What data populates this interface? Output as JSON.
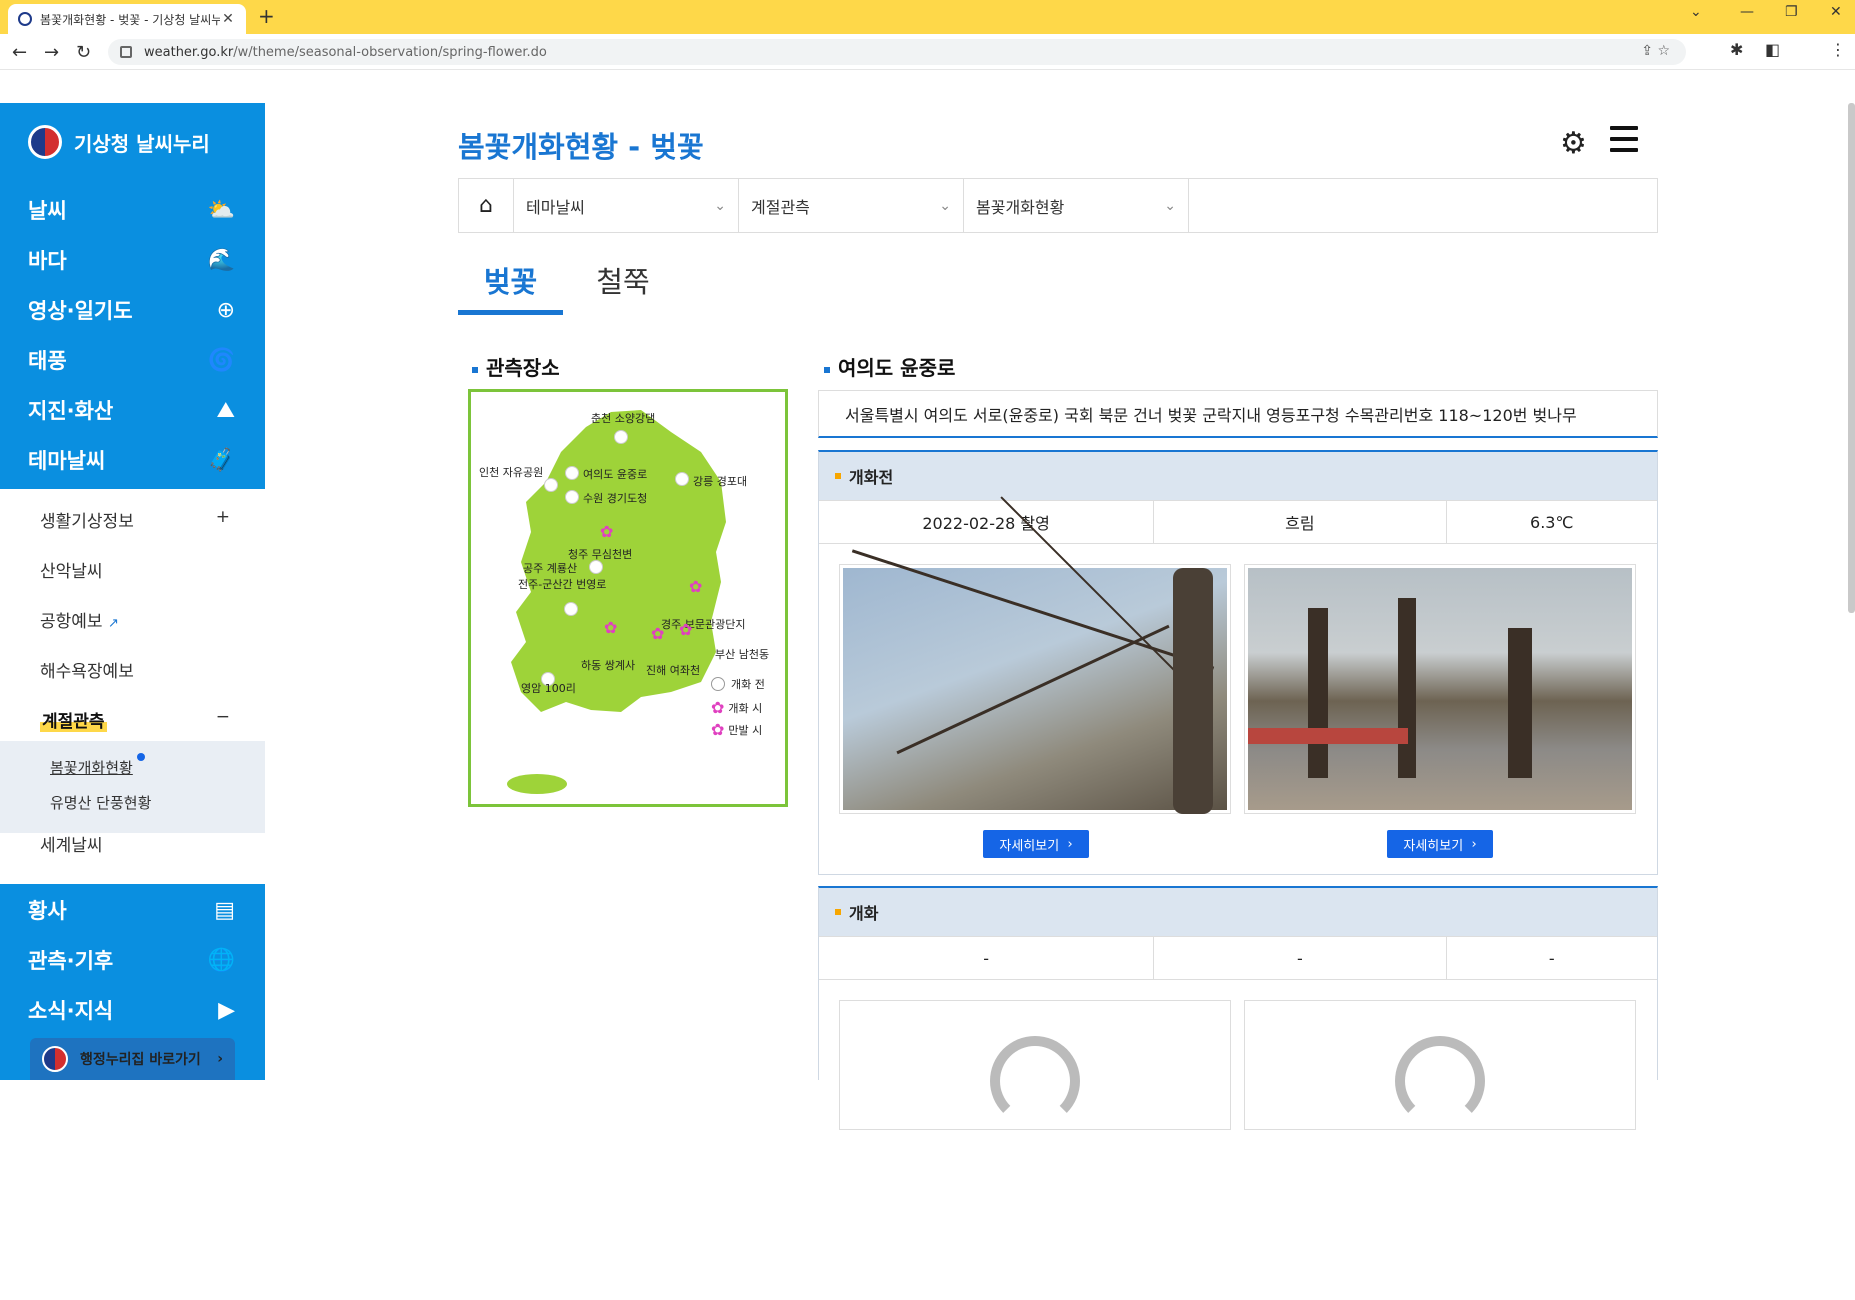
{
  "browser": {
    "tab_title": "봄꽃개화현황 - 벚꽃 - 기상청 날씨누리",
    "new_tab": "+",
    "url_host": "weather.go.kr",
    "url_path": "/w/theme/seasonal-observation/spring-flower.do"
  },
  "sidebar": {
    "logo": "기상청 날씨누리",
    "main_items": [
      {
        "label": "날씨",
        "icon": "weather-icon"
      },
      {
        "label": "바다",
        "icon": "sea-icon"
      },
      {
        "label": "영상·일기도",
        "icon": "radar-icon"
      },
      {
        "label": "태풍",
        "icon": "typhoon-icon"
      },
      {
        "label": "지진·화산",
        "icon": "earthquake-icon"
      },
      {
        "label": "테마날씨",
        "icon": "theme-icon"
      }
    ],
    "sub_items": [
      {
        "label": "생활기상정보",
        "toggle": "+"
      },
      {
        "label": "산악날씨",
        "toggle": ""
      },
      {
        "label": "공항예보",
        "toggle": ""
      },
      {
        "label": "해수욕장예보",
        "toggle": ""
      },
      {
        "label": "계절관측",
        "toggle": "−"
      }
    ],
    "subsub_items": [
      "봄꽃개화현황",
      "유명산 단풍현황"
    ],
    "sub_after": "세계날씨",
    "bottom_items": [
      {
        "label": "황사",
        "icon": "dust-icon"
      },
      {
        "label": "관측·기후",
        "icon": "climate-icon"
      },
      {
        "label": "소식·지식",
        "icon": "news-icon"
      }
    ],
    "gov_link": "행정누리집 바로가기"
  },
  "main": {
    "title": "봄꽃개화현황 - 벚꽃",
    "breadcrumb": [
      "테마날씨",
      "계절관측",
      "봄꽃개화현황"
    ],
    "tabs": [
      "벚꽃",
      "철쭉"
    ],
    "map_title": "관측장소",
    "map_labels": {
      "chuncheon": "춘천 소양강댐",
      "incheon": "인천 자유공원",
      "yeouido": "여의도 윤중로",
      "suwon": "수원 경기도청",
      "gangneung": "강릉 경포대",
      "cheongju": "청주 무심천변",
      "gongju": "공주 계룡산",
      "jeonju": "전주-군산간 번영로",
      "gyeongju": "경주 보문관광단지",
      "busan": "부산 남천동",
      "hadong": "하동 쌍계사",
      "jinhae": "진해 여좌천",
      "yeongam": "영암 100리"
    },
    "legend": [
      "개화 전",
      "개화 시",
      "만발 시"
    ],
    "spot_title": "여의도 윤중로",
    "spot_desc": "서울특별시 여의도 서로(윤중로) 국회 북문 건너 벚꽃 군락지내 영등포구청 수목관리번호 118~120번 벚나무",
    "stage1": {
      "title": "개화전",
      "date": "2022-02-28 촬영",
      "weather": "흐림",
      "temp": "6.3℃",
      "more": "자세히보기"
    },
    "stage2": {
      "title": "개화",
      "date": "-",
      "weather": "-",
      "temp": "-"
    }
  }
}
